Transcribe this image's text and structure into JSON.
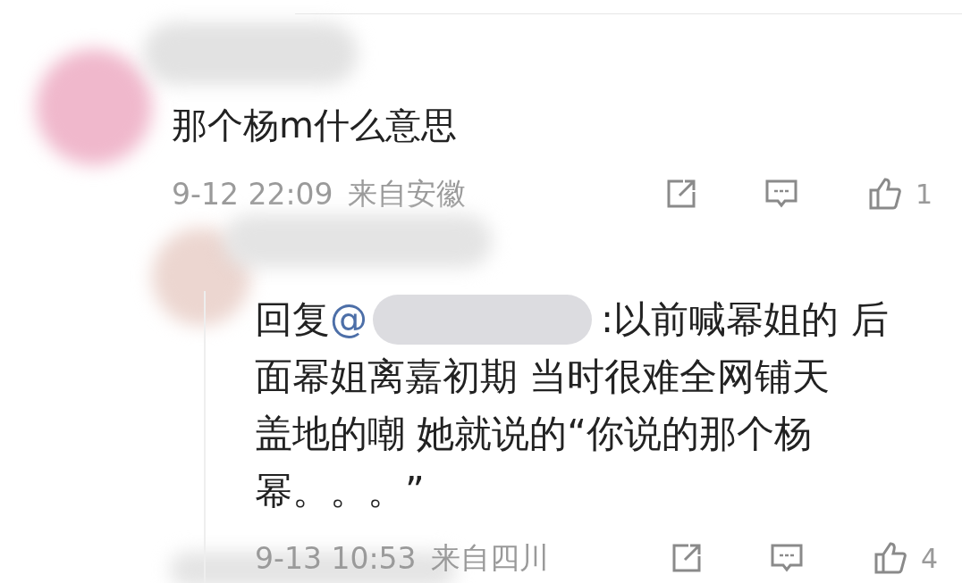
{
  "comment": {
    "text": "那个杨m什么意思",
    "time": "9-12 22:09",
    "location": "来自安徽",
    "likes": "1"
  },
  "reply": {
    "prefix": "回复",
    "mention": "@",
    "lines": [
      ":以前喊幂姐的 后",
      "面幂姐离嘉初期 当时很难全网铺天",
      "盖地的嘲 她就说的“你说的那个杨",
      "幂。。。”"
    ],
    "time": "9-13 10:53",
    "location": "来自四川",
    "likes": "4"
  }
}
